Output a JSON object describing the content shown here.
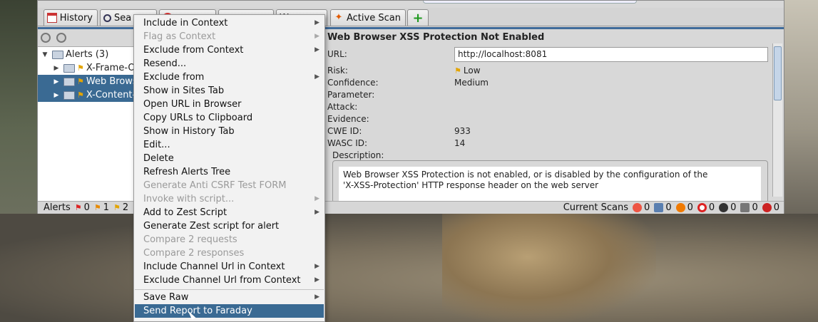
{
  "tabs": [
    {
      "label": "History",
      "icon": "calendar-icon"
    },
    {
      "label": "Sea",
      "icon": "search-icon"
    },
    {
      "label": "",
      "icon": "flag-icon"
    },
    {
      "label": "",
      "icon": "blank-tab"
    },
    {
      "label": "W",
      "icon": "blank-tab"
    },
    {
      "label": "Active Scan",
      "icon": "flame-icon"
    }
  ],
  "add_tab": "+",
  "tree": {
    "root": "Alerts (3)",
    "items": [
      {
        "label": "X-Frame-Op",
        "selected": false
      },
      {
        "label": "Web Brows",
        "selected": true
      },
      {
        "label": "X-Content-T",
        "selected": true
      }
    ]
  },
  "detail": {
    "title": "Web Browser XSS Protection Not Enabled",
    "url_label": "URL:",
    "url_value": "http://localhost:8081",
    "risk_label": "Risk:",
    "risk_value": "Low",
    "confidence_label": "Confidence:",
    "confidence_value": "Medium",
    "parameter_label": "Parameter:",
    "attack_label": "Attack:",
    "evidence_label": "Evidence:",
    "cwe_label": "CWE ID:",
    "cwe_value": "933",
    "wasc_label": "WASC ID:",
    "wasc_value": "14",
    "description_label": "Description:",
    "description_line1": "Web Browser XSS Protection is not enabled, or is disabled by the configuration of the",
    "description_line2": "'X-XSS-Protection' HTTP response header on the web server"
  },
  "status": {
    "alerts_label": "Alerts",
    "high": "0",
    "medium": "1",
    "low": "2",
    "current_scans_label": "Current Scans",
    "scan_counts": [
      "0",
      "0",
      "0",
      "0",
      "0",
      "0",
      "0"
    ]
  },
  "menu": {
    "items": [
      {
        "label": "Include in Context",
        "disabled": false,
        "submenu": true
      },
      {
        "label": "Flag as Context",
        "disabled": true,
        "submenu": true
      },
      {
        "label": "Exclude from Context",
        "disabled": false,
        "submenu": true
      },
      {
        "label": "Resend...",
        "disabled": false,
        "submenu": false
      },
      {
        "label": "Exclude from",
        "disabled": false,
        "submenu": true
      },
      {
        "label": "Show in Sites Tab",
        "disabled": false,
        "submenu": false
      },
      {
        "label": "Open URL in Browser",
        "disabled": false,
        "submenu": false
      },
      {
        "label": "Copy URLs to Clipboard",
        "disabled": false,
        "submenu": false
      },
      {
        "label": "Show in History Tab",
        "disabled": false,
        "submenu": false
      },
      {
        "label": "Edit...",
        "disabled": false,
        "submenu": false
      },
      {
        "label": "Delete",
        "disabled": false,
        "submenu": false
      },
      {
        "label": "Refresh Alerts Tree",
        "disabled": false,
        "submenu": false
      },
      {
        "label": "Generate Anti CSRF Test FORM",
        "disabled": true,
        "submenu": false
      },
      {
        "label": "Invoke with script...",
        "disabled": true,
        "submenu": true
      },
      {
        "label": "Add to Zest Script",
        "disabled": false,
        "submenu": true
      },
      {
        "label": "Generate Zest script for alert",
        "disabled": false,
        "submenu": false
      },
      {
        "label": "Compare 2 requests",
        "disabled": true,
        "submenu": false
      },
      {
        "label": "Compare 2 responses",
        "disabled": true,
        "submenu": false
      },
      {
        "label": "Include Channel Url in Context",
        "disabled": false,
        "submenu": true
      },
      {
        "label": "Exclude Channel Url from Context",
        "disabled": false,
        "submenu": true
      }
    ],
    "items_after_separator": [
      {
        "label": "Save Raw",
        "disabled": false,
        "submenu": true
      },
      {
        "label": "Send Report to Faraday",
        "disabled": false,
        "submenu": false,
        "selected": true
      }
    ]
  }
}
